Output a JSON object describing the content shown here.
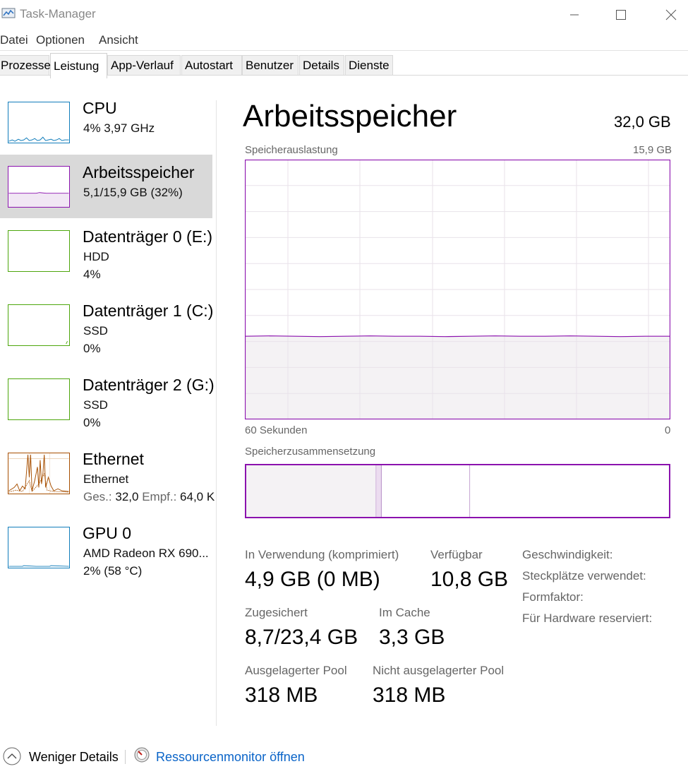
{
  "window": {
    "title": "Task-Manager"
  },
  "menu": [
    "Datei",
    "Optionen",
    "Ansicht"
  ],
  "tabs": [
    "Prozesse",
    "Leistung",
    "App-Verlauf",
    "Autostart",
    "Benutzer",
    "Details",
    "Dienste"
  ],
  "sidebar": {
    "cpu": {
      "title": "CPU",
      "line1": "4%  3,97 GHz"
    },
    "memory": {
      "title": "Arbeitsspeicher",
      "line1": "5,1/15,9 GB (32%)"
    },
    "disk0": {
      "title": "Datenträger 0 (E:)",
      "line1": "HDD",
      "line2": "4%"
    },
    "disk1": {
      "title": "Datenträger 1 (C:)",
      "line1": "SSD",
      "line2": "0%"
    },
    "disk2": {
      "title": "Datenträger 2 (G:)",
      "line1": "SSD",
      "line2": "0%"
    },
    "ethernet": {
      "title": "Ethernet",
      "line1": "Ethernet",
      "send_label": "Ges.:",
      "send_value": "32,0",
      "recv_label": "Empf.:",
      "recv_value": "64,0 K"
    },
    "gpu": {
      "title": "GPU 0",
      "line1": "AMD Radeon RX 690...",
      "line2": "2%  (58 °C)"
    }
  },
  "main": {
    "title": "Arbeitsspeicher",
    "total": "32,0 GB",
    "graph_label": "Speicherauslastung",
    "graph_max": "15,9 GB",
    "axis_left": "60 Sekunden",
    "axis_right": "0",
    "usage_fraction": 0.32,
    "composition_label": "Speicherzusammensetzung",
    "composition": {
      "in_use_gb": 4.9,
      "modified_gb": 0.2,
      "standby_gb": 3.3,
      "free_gb": 7.5,
      "total_gb": 15.9
    },
    "stats": {
      "in_use_label": "In Verwendung (komprimiert)",
      "in_use_value": "4,9 GB (0 MB)",
      "available_label": "Verfügbar",
      "available_value": "10,8 GB",
      "committed_label": "Zugesichert",
      "committed_value": "8,7/23,4 GB",
      "cached_label": "Im Cache",
      "cached_value": "3,3 GB",
      "paged_label": "Ausgelagerter Pool",
      "paged_value": "318 MB",
      "nonpaged_label": "Nicht ausgelagerter Pool",
      "nonpaged_value": "318 MB"
    },
    "right": {
      "speed_label": "Geschwindigkeit:",
      "slots_label": "Steckplätze verwendet:",
      "form_label": "Formfaktor:",
      "reserved_label": "Für Hardware reserviert:"
    }
  },
  "footer": {
    "less_details": "Weniger Details",
    "resmon": "Ressourcenmonitor öffnen"
  },
  "colors": {
    "memory": "#8b12ae",
    "memory_fill": "#f4f2f4",
    "cpu": "#117dbb",
    "disk": "#4da60c",
    "ethernet": "#a74f01",
    "link": "#0a64c8"
  }
}
